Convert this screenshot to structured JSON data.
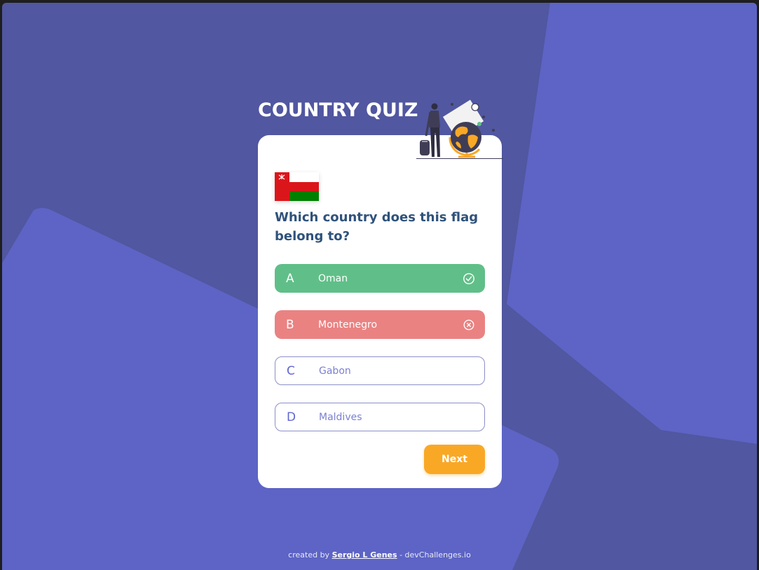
{
  "app": {
    "title": "COUNTRY QUIZ"
  },
  "illustration": {
    "icon": "adventure-globe-illustration"
  },
  "question": {
    "flag_icon": "oman-flag-icon",
    "text": "Which country does this flag belong to?"
  },
  "options": [
    {
      "letter": "A",
      "label": "Oman",
      "state": "correct",
      "icon": "check-circle-icon"
    },
    {
      "letter": "B",
      "label": "Montenegro",
      "state": "wrong",
      "icon": "x-circle-icon"
    },
    {
      "letter": "C",
      "label": "Gabon",
      "state": "default"
    },
    {
      "letter": "D",
      "label": "Maldives",
      "state": "default"
    }
  ],
  "next_button": {
    "label": "Next"
  },
  "footer": {
    "prefix": "created by ",
    "author": "Sergio L Genes",
    "suffix": " - devChallenges.io"
  },
  "colors": {
    "background": "#5157a0",
    "shape": "#5d64c5",
    "correct": "#60bf88",
    "wrong": "#ea8282",
    "accent": "#f9a826",
    "question_text": "#2f527b"
  }
}
